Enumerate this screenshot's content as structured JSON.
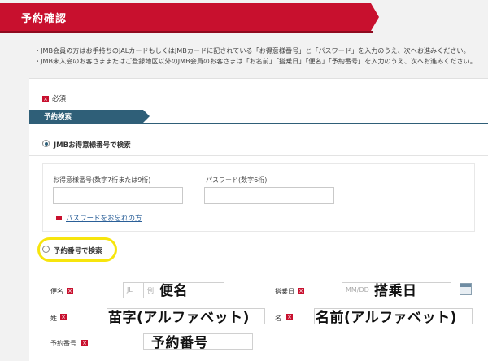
{
  "header": {
    "title": "予約確認"
  },
  "notes": [
    "・JMB会員の方はお手持ちのJALカードもしくはJMBカードに記されている「お得意様番号」と「パスワード」を入力のうえ、次へお進みください。",
    "・JMB未入会のお客さままたはご登録地区以外のJMB会員のお客さまは「お名前」「搭乗日」「便名」「予約番号」を入力のうえ、次へお進みください。"
  ],
  "required": {
    "mark": "×",
    "label": "必須"
  },
  "section": {
    "title": "予約検索"
  },
  "jmb": {
    "radio_label": "JMBお得意様番号で検索",
    "selected": true,
    "member_no_label": "お得意様番号(数字7桁または9桁)",
    "password_label": "パスワード(数字6桁)",
    "forgot_link": "パスワードをお忘れの方"
  },
  "reservation": {
    "radio_label": "予約番号で検索",
    "selected": false,
    "flight_label": "便名",
    "flight_prefix": "JL",
    "flight_placeholder": "例",
    "flight_overlay": "便名",
    "date_label": "搭乗日",
    "date_placeholder": "MM/DD",
    "date_overlay": "搭乗日",
    "surname_label": "姓",
    "surname_overlay": "苗字(アルファベット)",
    "given_label": "名",
    "given_overlay": "名前(アルファベット)",
    "resno_label": "予約番号",
    "resno_overlay": "予約番号"
  },
  "colors": {
    "brand_red": "#c8102e",
    "section_blue": "#2f5f78",
    "highlight_yellow": "#f7e50d"
  }
}
